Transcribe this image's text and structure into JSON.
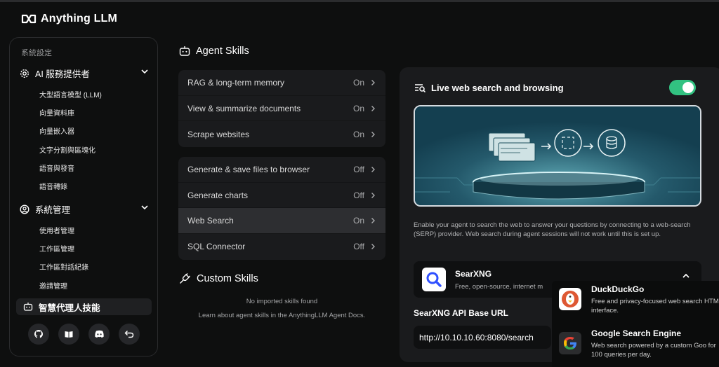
{
  "app": {
    "name": "Anything LLM"
  },
  "sidebar": {
    "caption": "系統設定",
    "sections": [
      {
        "label": "AI 服務提供者",
        "icon": "gear-icon",
        "items": [
          "大型語言模型 (LLM)",
          "向量資料庫",
          "向量嵌入器",
          "文字分割與區塊化",
          "語音與發音",
          "語音轉錄"
        ]
      },
      {
        "label": "系統管理",
        "icon": "user-gear-icon",
        "items": [
          "使用者管理",
          "工作區管理",
          "工作區對話紀錄",
          "邀請管理"
        ]
      }
    ],
    "active": "智慧代理人技能",
    "footer_icons": [
      "github-icon",
      "book-icon",
      "discord-icon",
      "back-icon"
    ]
  },
  "agent_skills": {
    "title": "Agent Skills",
    "default_skills": [
      {
        "label": "RAG & long-term memory",
        "status": "On"
      },
      {
        "label": "View & summarize documents",
        "status": "On"
      },
      {
        "label": "Scrape websites",
        "status": "On"
      }
    ],
    "configurable_skills": [
      {
        "label": "Generate & save files to browser",
        "status": "Off"
      },
      {
        "label": "Generate charts",
        "status": "Off"
      },
      {
        "label": "Web Search",
        "status": "On"
      },
      {
        "label": "SQL Connector",
        "status": "Off"
      }
    ]
  },
  "custom_skills": {
    "title": "Custom Skills",
    "empty": "No imported skills found",
    "docs_link": "Learn about agent skills in the AnythingLLM Agent Docs."
  },
  "web_search": {
    "title": "Live web search and browsing",
    "enabled": true,
    "description": "Enable your agent to search the web to answer your questions by connecting to a web-search (SERP) provider. Web search during agent sessions will not work until this is set up.",
    "provider": {
      "name": "SearXNG",
      "description": "Free, open-source, internet m"
    },
    "api_label": "SearXNG API Base URL",
    "api_value": "http://10.10.10.60:8080/search"
  },
  "provider_dropdown": [
    {
      "name": "DuckDuckGo",
      "description": "Free and privacy-focused web search HTML interface."
    },
    {
      "name": "Google Search Engine",
      "description": "Web search powered by a custom Goo for 100 queries per day."
    }
  ],
  "colors": {
    "accent_green": "#32c281",
    "panel": "#1a1b1d",
    "background": "#0e0f0f"
  }
}
